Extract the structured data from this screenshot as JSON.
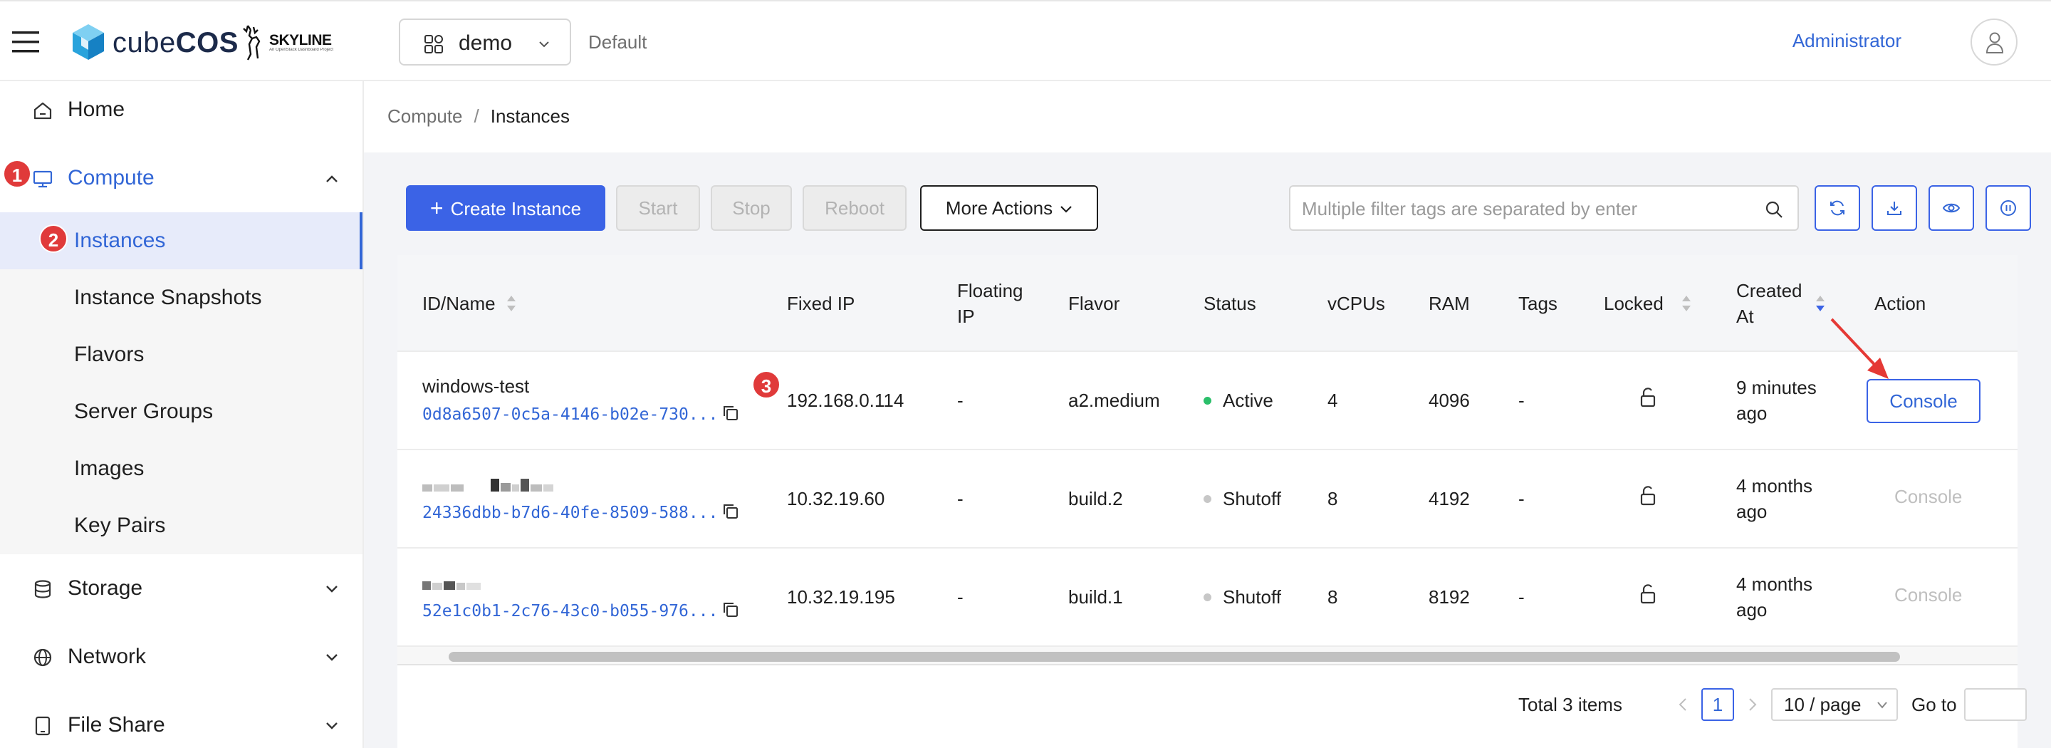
{
  "header": {
    "logo_text_light": "cube",
    "logo_text_bold": "COS",
    "skyline_text": "SKYLINE",
    "skyline_sub": "An OpenStack Dashboard Project",
    "project": "demo",
    "domain": "Default",
    "user": "Administrator"
  },
  "sidebar": {
    "items": [
      {
        "label": "Home",
        "icon": "home-icon"
      },
      {
        "label": "Compute",
        "icon": "desktop-icon",
        "expanded": true
      },
      {
        "label": "Storage",
        "icon": "database-icon"
      },
      {
        "label": "Network",
        "icon": "globe-icon"
      },
      {
        "label": "File Share",
        "icon": "tablet-icon"
      }
    ],
    "compute_sub": [
      {
        "label": "Instances",
        "selected": true
      },
      {
        "label": "Instance Snapshots"
      },
      {
        "label": "Flavors"
      },
      {
        "label": "Server Groups"
      },
      {
        "label": "Images"
      },
      {
        "label": "Key Pairs"
      }
    ]
  },
  "annotations": {
    "b1": "1",
    "b2": "2",
    "b3": "3",
    "badge_color": "#e03a3a",
    "arrow_color": "#e53935"
  },
  "breadcrumb": {
    "parent": "Compute",
    "separator": "/",
    "current": "Instances"
  },
  "toolbar": {
    "create": "Create Instance",
    "start": "Start",
    "stop": "Stop",
    "reboot": "Reboot",
    "more": "More Actions",
    "search_placeholder": "Multiple filter tags are separated by enter",
    "icon_buttons": [
      "refresh-icon",
      "download-icon",
      "eye-icon",
      "pause-icon"
    ]
  },
  "table": {
    "columns": {
      "id_name": "ID/Name",
      "fixed_ip": "Fixed IP",
      "floating_ip_1": "Floating",
      "floating_ip_2": "IP",
      "flavor": "Flavor",
      "status": "Status",
      "vcpus": "vCPUs",
      "ram": "RAM",
      "tags": "Tags",
      "locked": "Locked",
      "created_1": "Created",
      "created_2": "At",
      "action": "Action"
    },
    "rows": [
      {
        "name": "windows-test",
        "id": "0d8a6507-0c5a-4146-b02e-730...",
        "fixed_ip": "192.168.0.114",
        "floating_ip": "-",
        "flavor": "a2.medium",
        "status": "Active",
        "status_color": "#2bbf6a",
        "vcpus": "4",
        "ram": "4096",
        "tags": "-",
        "created_1": "9 minutes",
        "created_2": "ago",
        "action": "Console",
        "action_enabled": true
      },
      {
        "name": "",
        "id": "24336dbb-b7d6-40fe-8509-588...",
        "fixed_ip": "10.32.19.60",
        "floating_ip": "-",
        "flavor": "build.2",
        "status": "Shutoff",
        "status_color": "#c7c7c7",
        "vcpus": "8",
        "ram": "4192",
        "tags": "-",
        "created_1": "4 months",
        "created_2": "ago",
        "action": "Console",
        "action_enabled": false
      },
      {
        "name": "",
        "id": "52e1c0b1-2c76-43c0-b055-976...",
        "fixed_ip": "10.32.19.195",
        "floating_ip": "-",
        "flavor": "build.1",
        "status": "Shutoff",
        "status_color": "#c7c7c7",
        "vcpus": "8",
        "ram": "8192",
        "tags": "-",
        "created_1": "4 months",
        "created_2": "ago",
        "action": "Console",
        "action_enabled": false
      }
    ]
  },
  "pagination": {
    "total": "Total 3 items",
    "current": "1",
    "page_size": "10 / page",
    "goto": "Go to"
  }
}
